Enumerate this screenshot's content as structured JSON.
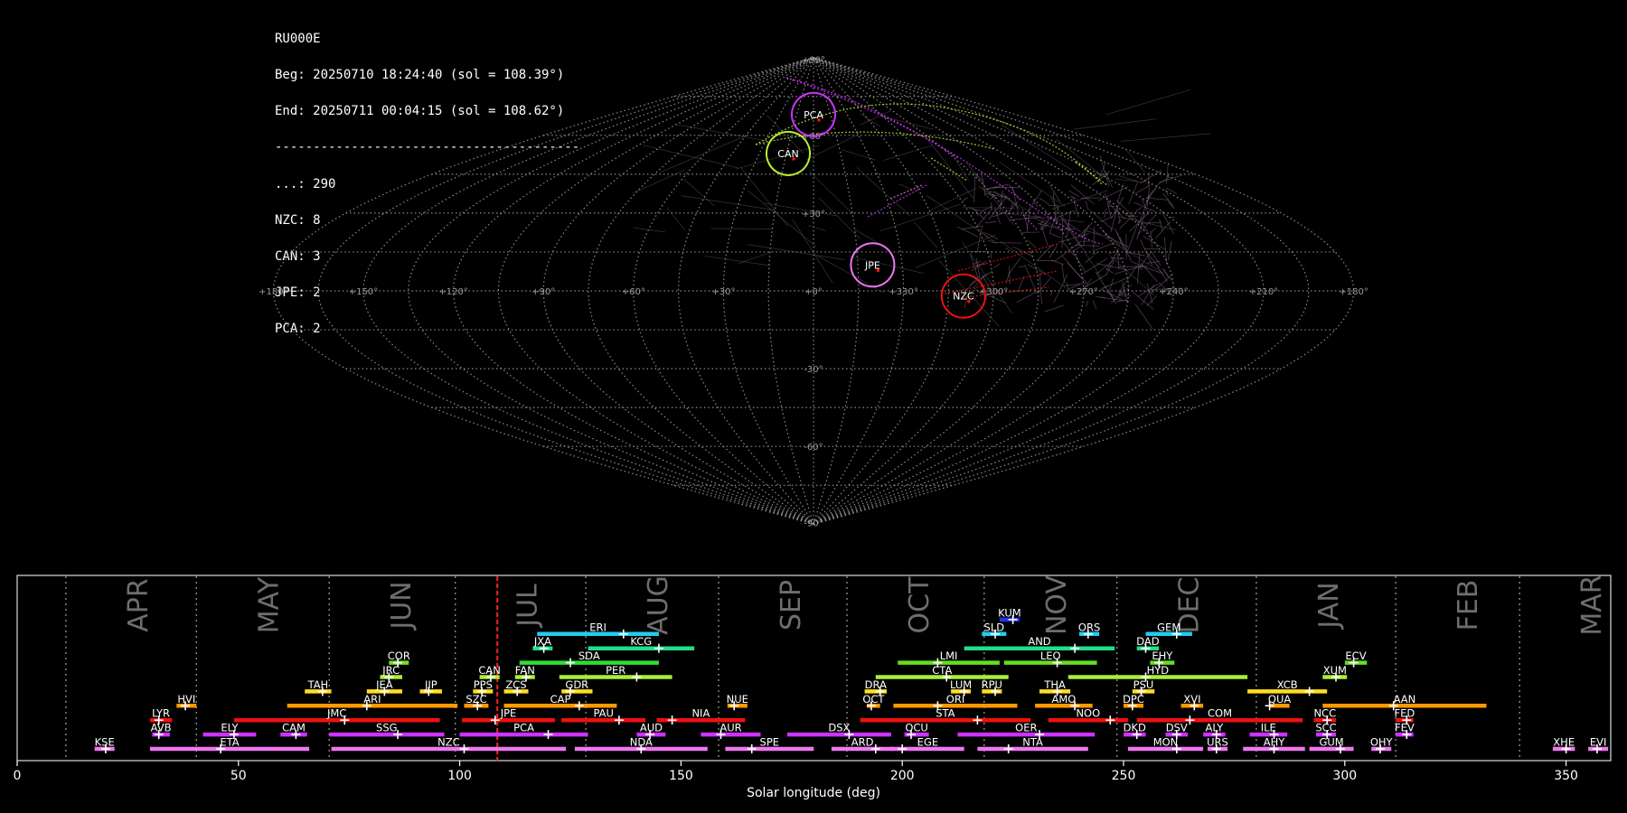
{
  "info": {
    "station": "RU000E",
    "begin": "Beg: 20250710 18:24:40 (sol = 108.39°)",
    "end": "End: 20250711 00:04:15 (sol = 108.62°)",
    "separator": "----------------------------------------",
    "counts": [
      "...: 290",
      "NZC: 8",
      "CAN: 3",
      "JPE: 2",
      "PCA: 2"
    ]
  },
  "chart_data": [
    {
      "type": "scatter",
      "projection": "sinusoidal",
      "lat_labels": [
        "+90°",
        "+60°",
        "+30°",
        "-30°",
        "-60°",
        "-90°"
      ],
      "lon_labels": [
        "+180°",
        "+150°",
        "+120°",
        "+90°",
        "+60°",
        "+30°",
        "+0°",
        "+330°",
        "+300°",
        "+270°",
        "+240°",
        "+210°",
        "+180°"
      ],
      "grid": true,
      "radiants": [
        {
          "name": "PCA",
          "lon": 0,
          "lat": 68,
          "color": "#cc33ff"
        },
        {
          "name": "CAN",
          "lon": 14,
          "lat": 53,
          "color": "#bbee33"
        },
        {
          "name": "JPE",
          "lon": 340,
          "lat": 10,
          "color": "#ee77ee"
        },
        {
          "name": "NZC",
          "lon": 310,
          "lat": -2,
          "color": "#ee1111"
        }
      ]
    },
    {
      "type": "timeline",
      "xlabel": "Solar longitude (deg)",
      "xlim": [
        0,
        360
      ],
      "xticks": [
        0,
        50,
        100,
        150,
        200,
        250,
        300,
        350
      ],
      "current_sol": 108.5,
      "months": [
        {
          "name": "APR",
          "start": 11
        },
        {
          "name": "MAY",
          "start": 40.5
        },
        {
          "name": "JUN",
          "start": 70.5
        },
        {
          "name": "JUL",
          "start": 99
        },
        {
          "name": "AUG",
          "start": 128.5
        },
        {
          "name": "SEP",
          "start": 158.5
        },
        {
          "name": "OCT",
          "start": 187.5
        },
        {
          "name": "NOV",
          "start": 218.5
        },
        {
          "name": "DEC",
          "start": 248.5
        },
        {
          "name": "JAN",
          "start": 280
        },
        {
          "name": "FEB",
          "start": 311.5
        },
        {
          "name": "MAR",
          "start": 339.5
        }
      ],
      "showers": [
        {
          "name": "KSE",
          "start": 17.5,
          "end": 22,
          "peak": 20,
          "row": 0,
          "color": "#ee77ee"
        },
        {
          "name": "ETA",
          "start": 30,
          "end": 66,
          "peak": 46,
          "row": 0,
          "color": "#ee77ee"
        },
        {
          "name": "NZC",
          "start": 71,
          "end": 124,
          "peak": 101,
          "row": 0,
          "color": "#ee77ee"
        },
        {
          "name": "NDA",
          "start": 126,
          "end": 156,
          "peak": 141,
          "row": 0,
          "color": "#ee77ee"
        },
        {
          "name": "SPE",
          "start": 160,
          "end": 180,
          "peak": 166,
          "row": 0,
          "color": "#ee77ee"
        },
        {
          "name": "ARD",
          "start": 184,
          "end": 198,
          "peak": 194,
          "row": 0,
          "color": "#ee77ee"
        },
        {
          "name": "EGE",
          "start": 197.5,
          "end": 214,
          "peak": 200,
          "row": 0,
          "color": "#ee77ee"
        },
        {
          "name": "NTA",
          "start": 217,
          "end": 242,
          "peak": 224,
          "row": 0,
          "color": "#ee77ee"
        },
        {
          "name": "MON",
          "start": 251,
          "end": 268,
          "peak": 262,
          "row": 0,
          "color": "#ee77ee"
        },
        {
          "name": "URS",
          "start": 269,
          "end": 273.5,
          "peak": 271,
          "row": 0,
          "color": "#ee77ee"
        },
        {
          "name": "AHY",
          "start": 277,
          "end": 291,
          "peak": 284,
          "row": 0,
          "color": "#ee77ee"
        },
        {
          "name": "GUM",
          "start": 292,
          "end": 302,
          "peak": 299,
          "row": 0,
          "color": "#ee77ee"
        },
        {
          "name": "OHY",
          "start": 306,
          "end": 310.5,
          "peak": 308,
          "row": 0,
          "color": "#ee77ee"
        },
        {
          "name": "XHE",
          "start": 347,
          "end": 352,
          "peak": 350,
          "row": 0,
          "color": "#ee77ee"
        },
        {
          "name": "EVI",
          "start": 355,
          "end": 359.5,
          "peak": 357,
          "row": 0,
          "color": "#ee77ee"
        },
        {
          "name": "AVB",
          "start": 30.5,
          "end": 34.5,
          "peak": 32,
          "row": 1,
          "color": "#cc33ff"
        },
        {
          "name": "ELY",
          "start": 42,
          "end": 54,
          "peak": 49,
          "row": 1,
          "color": "#cc33ff"
        },
        {
          "name": "CAM",
          "start": 59.5,
          "end": 65.5,
          "peak": 63,
          "row": 1,
          "color": "#cc33ff"
        },
        {
          "name": "SSG",
          "start": 70.5,
          "end": 96.5,
          "peak": 86,
          "row": 1,
          "color": "#cc33ff"
        },
        {
          "name": "PCA",
          "start": 100,
          "end": 129,
          "peak": 120,
          "row": 1,
          "color": "#cc33ff"
        },
        {
          "name": "AUD",
          "start": 140,
          "end": 146.5,
          "peak": 143,
          "row": 1,
          "color": "#cc33ff"
        },
        {
          "name": "AUR",
          "start": 154.5,
          "end": 168,
          "peak": 159,
          "row": 1,
          "color": "#cc33ff"
        },
        {
          "name": "DSX",
          "start": 174,
          "end": 197.5,
          "peak": 188,
          "row": 1,
          "color": "#cc33ff"
        },
        {
          "name": "OCU",
          "start": 200.5,
          "end": 206,
          "peak": 202,
          "row": 1,
          "color": "#cc33ff"
        },
        {
          "name": "OER",
          "start": 212.5,
          "end": 243.5,
          "peak": 231,
          "row": 1,
          "color": "#cc33ff"
        },
        {
          "name": "DKD",
          "start": 250,
          "end": 255,
          "peak": 253,
          "row": 1,
          "color": "#cc33ff"
        },
        {
          "name": "DSV",
          "start": 259.5,
          "end": 264.5,
          "peak": 262,
          "row": 1,
          "color": "#cc33ff"
        },
        {
          "name": "ALY",
          "start": 268,
          "end": 273,
          "peak": 271,
          "row": 1,
          "color": "#cc33ff"
        },
        {
          "name": "ILE",
          "start": 278.5,
          "end": 287,
          "peak": 284,
          "row": 1,
          "color": "#cc33ff"
        },
        {
          "name": "SCC",
          "start": 293.5,
          "end": 298,
          "peak": 296,
          "row": 1,
          "color": "#cc33ff"
        },
        {
          "name": "FEV",
          "start": 311.5,
          "end": 315.5,
          "peak": 314,
          "row": 1,
          "color": "#cc33ff"
        },
        {
          "name": "LYR",
          "start": 30,
          "end": 35,
          "peak": 32,
          "row": 2,
          "color": "#ee1111"
        },
        {
          "name": "JMC",
          "start": 49,
          "end": 95.5,
          "peak": 74,
          "row": 2,
          "color": "#ee1111"
        },
        {
          "name": "JPE",
          "start": 100.5,
          "end": 121.5,
          "peak": 108,
          "row": 2,
          "color": "#ee1111"
        },
        {
          "name": "PAU",
          "start": 123,
          "end": 142,
          "peak": 136,
          "row": 2,
          "color": "#ee1111"
        },
        {
          "name": "NIA",
          "start": 144.5,
          "end": 164.5,
          "peak": 148,
          "row": 2,
          "color": "#ee1111"
        },
        {
          "name": "STA",
          "start": 190.5,
          "end": 229,
          "peak": 217,
          "row": 2,
          "color": "#ee1111"
        },
        {
          "name": "NOO",
          "start": 233,
          "end": 251,
          "peak": 247,
          "row": 2,
          "color": "#ee1111"
        },
        {
          "name": "COM",
          "start": 253,
          "end": 290.5,
          "peak": 265,
          "row": 2,
          "color": "#ee1111"
        },
        {
          "name": "NCC",
          "start": 293,
          "end": 298,
          "peak": 296,
          "row": 2,
          "color": "#ee1111"
        },
        {
          "name": "FED",
          "start": 311.5,
          "end": 315.5,
          "peak": 314,
          "row": 2,
          "color": "#ee1111"
        },
        {
          "name": "HVI",
          "start": 36,
          "end": 40.5,
          "peak": 38,
          "row": 3,
          "color": "#ff9900"
        },
        {
          "name": "ARI",
          "start": 61,
          "end": 99.5,
          "peak": 79,
          "row": 3,
          "color": "#ff9900"
        },
        {
          "name": "SZC",
          "start": 101,
          "end": 106.5,
          "peak": 104,
          "row": 3,
          "color": "#ff9900"
        },
        {
          "name": "CAP",
          "start": 110,
          "end": 135.5,
          "peak": 127,
          "row": 3,
          "color": "#ff9900"
        },
        {
          "name": "NUE",
          "start": 160.5,
          "end": 165,
          "peak": 162,
          "row": 3,
          "color": "#ff9900"
        },
        {
          "name": "OCT",
          "start": 192,
          "end": 195,
          "peak": 193,
          "row": 3,
          "color": "#ff9900"
        },
        {
          "name": "ORI",
          "start": 198,
          "end": 226,
          "peak": 208,
          "row": 3,
          "color": "#ff9900"
        },
        {
          "name": "AMO",
          "start": 230,
          "end": 243,
          "peak": 239,
          "row": 3,
          "color": "#ff9900"
        },
        {
          "name": "DPC",
          "start": 250,
          "end": 254.5,
          "peak": 252,
          "row": 3,
          "color": "#ff9900"
        },
        {
          "name": "XVI",
          "start": 263,
          "end": 268,
          "peak": 266,
          "row": 3,
          "color": "#ff9900"
        },
        {
          "name": "QUA",
          "start": 283,
          "end": 287.5,
          "peak": 283,
          "row": 3,
          "color": "#ff9900"
        },
        {
          "name": "AAN",
          "start": 295,
          "end": 332,
          "peak": 311,
          "row": 3,
          "color": "#ff9900"
        },
        {
          "name": "TAH",
          "start": 65,
          "end": 71,
          "peak": 69,
          "row": 4,
          "color": "#ffdd22"
        },
        {
          "name": "JEA",
          "start": 79,
          "end": 87,
          "peak": 83,
          "row": 4,
          "color": "#ffdd22"
        },
        {
          "name": "JIP",
          "start": 91,
          "end": 96,
          "peak": 93,
          "row": 4,
          "color": "#ffdd22"
        },
        {
          "name": "PPS",
          "start": 103,
          "end": 107.5,
          "peak": 105,
          "row": 4,
          "color": "#ffdd22"
        },
        {
          "name": "ZCS",
          "start": 110,
          "end": 115.5,
          "peak": 113,
          "row": 4,
          "color": "#ffdd22"
        },
        {
          "name": "GDR",
          "start": 123,
          "end": 130,
          "peak": 125,
          "row": 4,
          "color": "#ffdd22"
        },
        {
          "name": "DRA",
          "start": 191.5,
          "end": 196.5,
          "peak": 195,
          "row": 4,
          "color": "#ffdd22"
        },
        {
          "name": "LUM",
          "start": 211,
          "end": 215.5,
          "peak": 214,
          "row": 4,
          "color": "#ffdd22"
        },
        {
          "name": "RPU",
          "start": 218,
          "end": 222.5,
          "peak": 221,
          "row": 4,
          "color": "#ffdd22"
        },
        {
          "name": "THA",
          "start": 231,
          "end": 238,
          "peak": 235,
          "row": 4,
          "color": "#ffdd22"
        },
        {
          "name": "PSU",
          "start": 252,
          "end": 257,
          "peak": 254,
          "row": 4,
          "color": "#ffdd22"
        },
        {
          "name": "XCB",
          "start": 278,
          "end": 296,
          "peak": 292,
          "row": 4,
          "color": "#ffdd22"
        },
        {
          "name": "JRC",
          "start": 82,
          "end": 87,
          "peak": 84,
          "row": 5,
          "color": "#aaee33"
        },
        {
          "name": "CAN",
          "start": 104.5,
          "end": 109,
          "peak": 107,
          "row": 5,
          "color": "#aaee33"
        },
        {
          "name": "FAN",
          "start": 112.5,
          "end": 117,
          "peak": 115,
          "row": 5,
          "color": "#aaee33"
        },
        {
          "name": "PER",
          "start": 122.5,
          "end": 148,
          "peak": 140,
          "row": 5,
          "color": "#aaee33"
        },
        {
          "name": "CTA",
          "start": 194,
          "end": 224,
          "peak": 210,
          "row": 5,
          "color": "#aaee33"
        },
        {
          "name": "HYD",
          "start": 237.5,
          "end": 278,
          "peak": 255,
          "row": 5,
          "color": "#aaee33"
        },
        {
          "name": "XUM",
          "start": 295,
          "end": 300.5,
          "peak": 298,
          "row": 5,
          "color": "#aaee33"
        },
        {
          "name": "COR",
          "start": 84,
          "end": 88.5,
          "peak": 86,
          "row": 6,
          "color": "#77dd22"
        },
        {
          "name": "SDA",
          "start": 113.5,
          "end": 145,
          "peak": 125,
          "row": 6,
          "color": "#33dd33"
        },
        {
          "name": "LMI",
          "start": 199,
          "end": 222,
          "peak": 208,
          "row": 6,
          "color": "#66dd22"
        },
        {
          "name": "LEO",
          "start": 223,
          "end": 244,
          "peak": 235,
          "row": 6,
          "color": "#66dd22"
        },
        {
          "name": "EHY",
          "start": 256,
          "end": 261.5,
          "peak": 258,
          "row": 6,
          "color": "#66dd22"
        },
        {
          "name": "ECV",
          "start": 300,
          "end": 305,
          "peak": 302,
          "row": 6,
          "color": "#66dd22"
        },
        {
          "name": "JXA",
          "start": 116.5,
          "end": 121,
          "peak": 119,
          "row": 7,
          "color": "#22dd88"
        },
        {
          "name": "KCG",
          "start": 129,
          "end": 153,
          "peak": 145,
          "row": 7,
          "color": "#22dd88"
        },
        {
          "name": "AND",
          "start": 214,
          "end": 248,
          "peak": 239,
          "row": 7,
          "color": "#22dd88"
        },
        {
          "name": "DAD",
          "start": 253,
          "end": 258,
          "peak": 255,
          "row": 7,
          "color": "#22dd88"
        },
        {
          "name": "ERI",
          "start": 117.5,
          "end": 145,
          "peak": 137,
          "row": 8,
          "color": "#22ccee"
        },
        {
          "name": "SLD",
          "start": 218,
          "end": 223.5,
          "peak": 221,
          "row": 8,
          "color": "#22ccee"
        },
        {
          "name": "ORS",
          "start": 240,
          "end": 244.5,
          "peak": 242,
          "row": 8,
          "color": "#22ccee"
        },
        {
          "name": "GEM",
          "start": 255,
          "end": 265.5,
          "peak": 262,
          "row": 8,
          "color": "#22ccee"
        },
        {
          "name": "KUM",
          "start": 222,
          "end": 226.5,
          "peak": 225,
          "row": 9,
          "color": "#2233ee"
        }
      ]
    }
  ]
}
